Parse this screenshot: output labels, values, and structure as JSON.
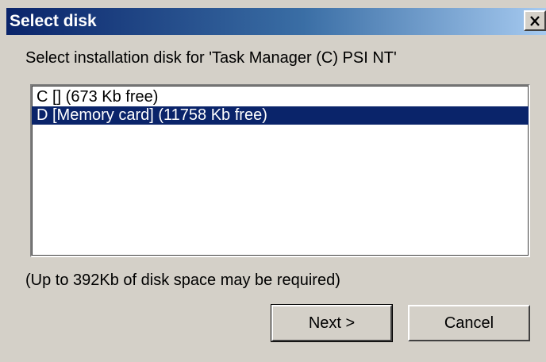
{
  "window": {
    "title": "Select disk",
    "close_icon": "close-icon"
  },
  "prompt": "Select installation disk for 'Task Manager (C) PSI NT'",
  "disks": [
    {
      "label": "C [] (673 Kb free)",
      "selected": false
    },
    {
      "label": "D [Memory card] (11758 Kb free)",
      "selected": true
    }
  ],
  "note": "(Up to 392Kb of disk space may be required)",
  "buttons": {
    "next": "Next >",
    "cancel": "Cancel"
  },
  "colors": {
    "title_bar_start": "#0a246a",
    "title_bar_end": "#a6caf0",
    "selection": "#0a246a",
    "face": "#d4d0c8"
  }
}
